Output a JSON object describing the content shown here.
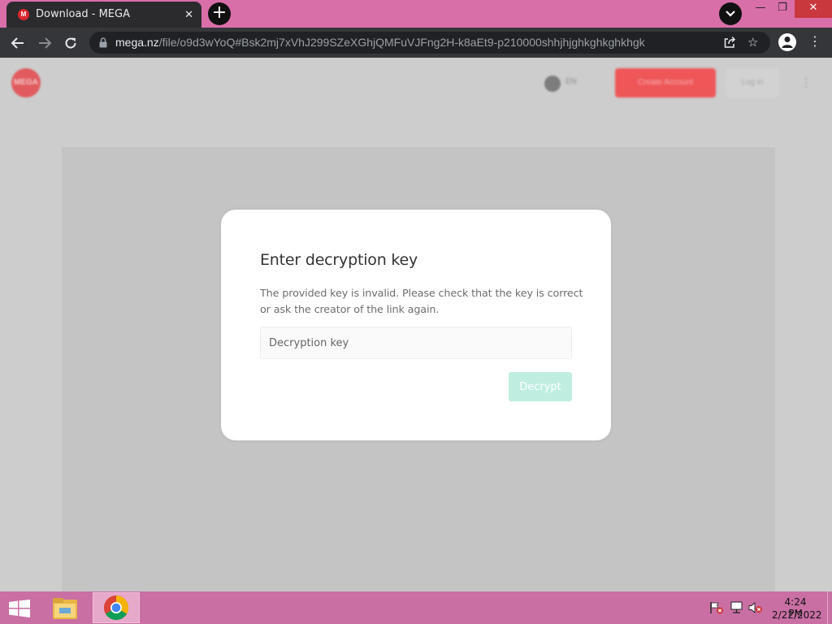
{
  "browser": {
    "tab": {
      "title": "Download - MEGA",
      "favicon_letter": "M"
    },
    "url": {
      "host": "mega.nz",
      "path": "/file/o9d3wYoQ#Bsk2mj7xVhJ299SZeXGhjQMFuVJFng2H-k8aEt9-p210000shhjhjghkghkghkhgk"
    },
    "colors": {
      "tabbar": "#d96fa9",
      "toolbar": "#35363a",
      "omnibox": "#202124"
    }
  },
  "mega_header": {
    "logo_text": "MEGA",
    "lang": "EN",
    "create_account": "Create Account",
    "login": "Log in"
  },
  "dialog": {
    "title": "Enter decryption key",
    "message": "The provided key is invalid. Please check that the key is correct or ask the creator of the link again.",
    "input_placeholder": "Decryption key",
    "input_value": "",
    "decrypt_label": "Decrypt",
    "colors": {
      "button_bg": "#bfeee1",
      "accent": "#00c8a0"
    }
  },
  "taskbar": {
    "time": "4:24 PM",
    "date": "2/22/2022",
    "color": "#c96fa3"
  }
}
